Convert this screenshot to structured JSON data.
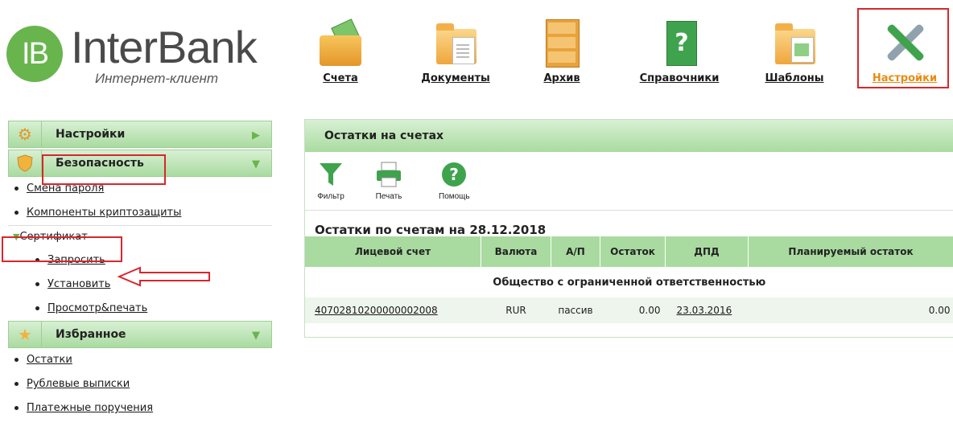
{
  "logo": {
    "badge": "IB",
    "name": "InterBank",
    "subtitle": "Интернет-клиент"
  },
  "topnav": [
    {
      "label": "Счета",
      "icon": "wallet-icon"
    },
    {
      "label": "Документы",
      "icon": "folder-documents-icon"
    },
    {
      "label": "Архив",
      "icon": "archive-cabinet-icon"
    },
    {
      "label": "Справочники",
      "icon": "help-book-icon"
    },
    {
      "label": "Шаблоны",
      "icon": "folder-templates-icon"
    },
    {
      "label": "Настройки",
      "icon": "tools-icon"
    }
  ],
  "sidebar": {
    "settings_title": "Настройки",
    "security_title": "Безопасность",
    "security_items": [
      "Смена пароля",
      "Компоненты криптозащиты"
    ],
    "certificate_title": "Сертификат",
    "certificate_items": [
      "Запросить",
      "Установить",
      "Просмотр&печать"
    ],
    "favorites_title": "Избранное",
    "favorites_items": [
      "Остатки",
      "Рублевые выписки",
      "Платежные поручения"
    ]
  },
  "panel": {
    "title": "Остатки на счетах",
    "toolbar": {
      "filter": "Фильтр",
      "print": "Печать",
      "help": "Помощь"
    },
    "section_title": "Остатки по счетам на 28.12.2018",
    "columns": [
      "Лицевой счет",
      "Валюта",
      "А/П",
      "Остаток",
      "ДПД",
      "Планируемый остаток"
    ],
    "group": "Общество с ограниченной ответственностью",
    "rows": [
      {
        "account": "40702810200000002008",
        "currency": "RUR",
        "ap": "пассив",
        "balance": "0.00",
        "dpd": "23.03.2016",
        "planned": "0.00"
      }
    ]
  },
  "colors": {
    "accent_green": "#68b54e",
    "header_green": "#a9dba0",
    "highlight_red": "#d9262c",
    "active_orange": "#e88b13"
  }
}
